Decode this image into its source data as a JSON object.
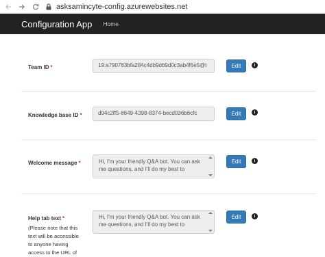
{
  "browser": {
    "url": "asksamincyte-config.azurewebsites.net",
    "back_icon": "back-arrow-icon",
    "forward_icon": "forward-arrow-icon",
    "reload_icon": "reload-icon",
    "lock_icon": "lock-icon"
  },
  "navbar": {
    "brand": "Configuration App",
    "home": "Home",
    "background": "#222222"
  },
  "fields": {
    "team_id": {
      "label": "Team ID",
      "required_mark": "*",
      "value": "19:a790783bfa284c4db9d69d0c3ab4f6e5@t",
      "edit_label": "Edit"
    },
    "knowledge_base_id": {
      "label": "Knowledge base ID",
      "required_mark": "*",
      "value": "d94c2ff5-8649-4398-8374-becd036b6cfc",
      "edit_label": "Edit"
    },
    "welcome_message": {
      "label": "Welcome message",
      "required_mark": "*",
      "value": "Hi, I'm your friendly Q&A bot. You can ask me questions, and I'll do my best to",
      "edit_label": "Edit"
    },
    "help_tab_text": {
      "label": "Help tab text",
      "required_mark": "*",
      "note": "(Please note that this text will be accessible to anyone having access to the URL of",
      "value": "Hi, I'm your friendly Q&A bot. You can ask me questions, and I'll do my best to",
      "edit_label": "Edit"
    }
  },
  "info_glyph": "i",
  "colors": {
    "primary_button": "#337ab7",
    "required": "#c9302c",
    "input_bg": "#eeeeee"
  }
}
